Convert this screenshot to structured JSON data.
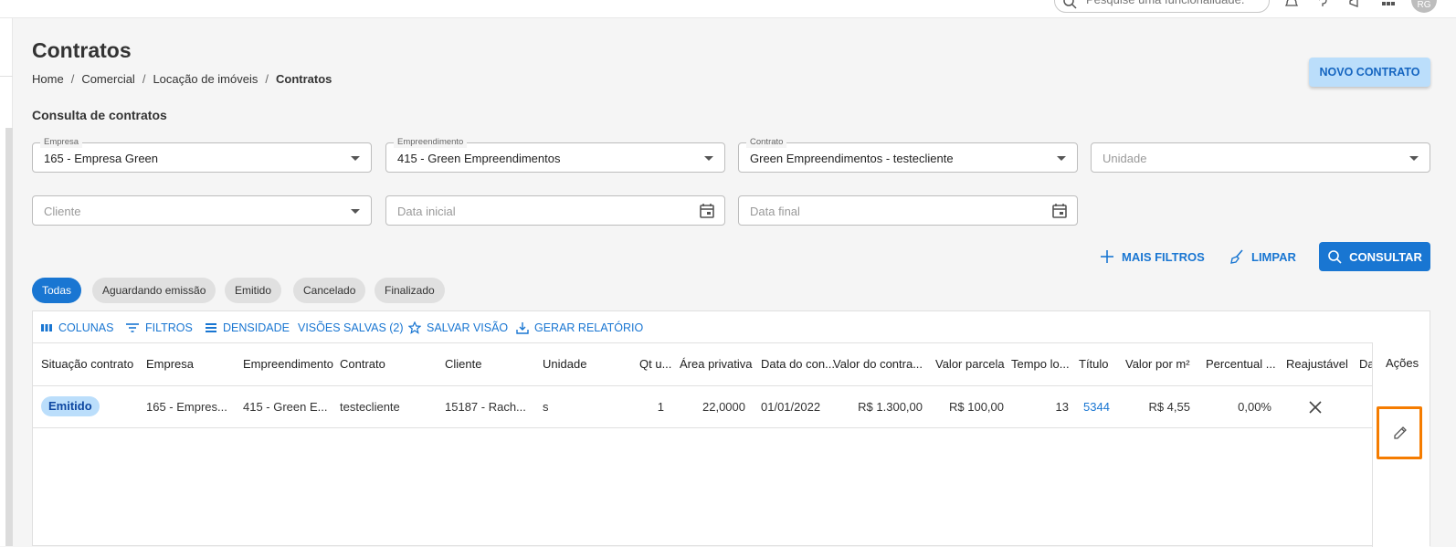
{
  "header": {
    "search_placeholder": "Pesquise uma funcionalidade.",
    "avatar_initials": "RG"
  },
  "page": {
    "title": "Contratos",
    "breadcrumb": [
      "Home",
      "Comercial",
      "Locação de imóveis",
      "Contratos"
    ],
    "new_button": "NOVO CONTRATO",
    "section_title": "Consulta de contratos"
  },
  "filters": {
    "empresa": {
      "label": "Empresa",
      "value": "165 - Empresa Green"
    },
    "empreendimento": {
      "label": "Empreendimento",
      "value": "415 - Green Empreendimentos"
    },
    "contrato": {
      "label": "Contrato",
      "value": "Green Empreendimentos - testecliente"
    },
    "unidade": {
      "placeholder": "Unidade"
    },
    "cliente": {
      "placeholder": "Cliente"
    },
    "data_inicial": {
      "placeholder": "Data inicial"
    },
    "data_final": {
      "placeholder": "Data final"
    }
  },
  "actions": {
    "mais_filtros": "MAIS FILTROS",
    "limpar": "LIMPAR",
    "consultar": "CONSULTAR"
  },
  "chips": [
    "Todas",
    "Aguardando emissão",
    "Emitido",
    "Cancelado",
    "Finalizado"
  ],
  "toolbar": {
    "colunas": "COLUNAS",
    "filtros": "FILTROS",
    "densidade": "DENSIDADE",
    "visoes": "VISÕES SALVAS (2)",
    "salvar": "SALVAR VISÃO",
    "relatorio": "GERAR RELATÓRIO"
  },
  "table": {
    "columns": [
      "Situação contrato",
      "Empresa",
      "Empreendimento",
      "Contrato",
      "Cliente",
      "Unidade",
      "Qt u...",
      "Área privativa",
      "Data do con...",
      "Valor do contra...",
      "Valor parcela",
      "Tempo lo...",
      "Título",
      "Valor por m²",
      "Percentual ...",
      "Reajustável",
      "Da"
    ],
    "actions_header": "Ações",
    "rows": [
      {
        "situacao": "Emitido",
        "empresa": "165 - Empres...",
        "empreendimento": "415 - Green E...",
        "contrato": "testecliente",
        "cliente": "15187 - Rach...",
        "unidade": "s",
        "qt": "1",
        "area": "22,0000",
        "data": "01/01/2022",
        "valor_contrato": "R$ 1.300,00",
        "valor_parcela": "R$ 100,00",
        "tempo": "13",
        "titulo": "5344",
        "valor_m2": "R$ 4,55",
        "percentual": "0,00%"
      }
    ]
  },
  "colors": {
    "primary": "#1976d2",
    "highlight": "#f57c00"
  }
}
